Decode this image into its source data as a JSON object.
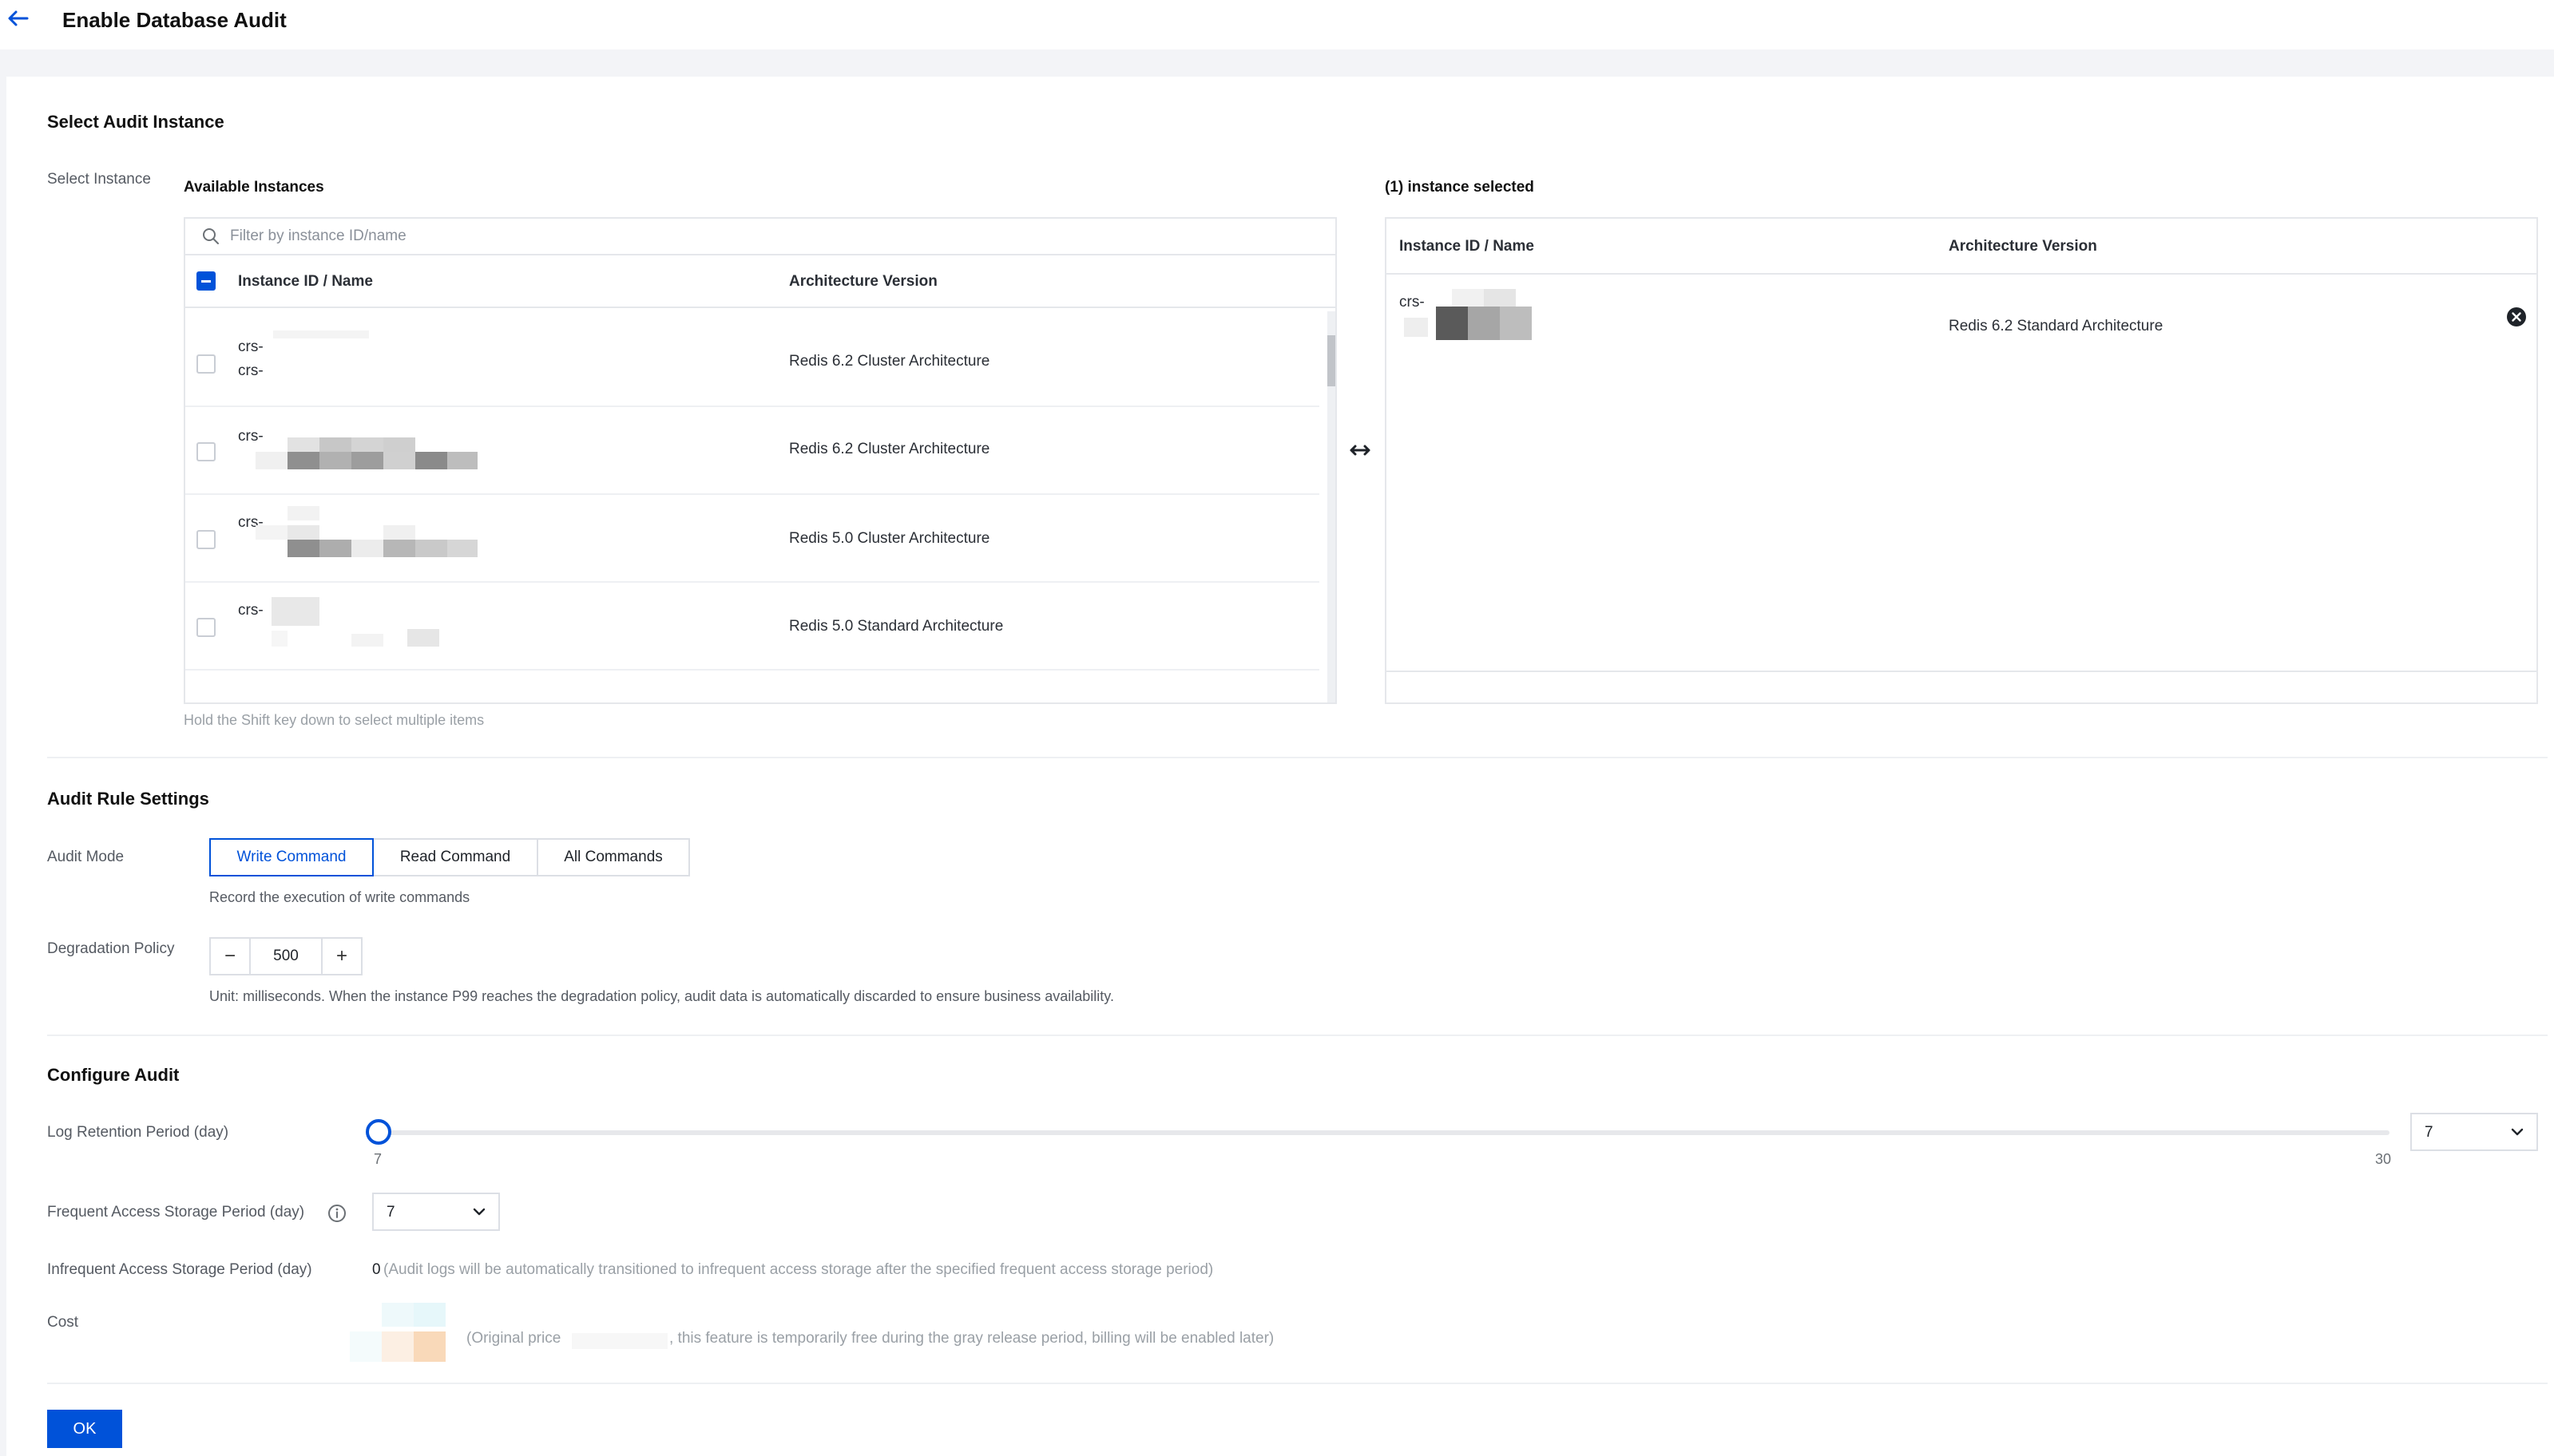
{
  "header": {
    "title": "Enable Database Audit"
  },
  "select_instance": {
    "section_title": "Select Audit Instance",
    "label": "Select Instance",
    "available": {
      "title": "Available Instances",
      "search_placeholder": "Filter by instance ID/name",
      "columns": [
        "Instance ID / Name",
        "Architecture Version"
      ],
      "rows": [
        {
          "id_line1": "crs-",
          "id_line2": "crs-",
          "version": "Redis 6.2 Cluster Architecture"
        },
        {
          "id_line1": "crs-",
          "id_line2": "",
          "version": "Redis 6.2 Cluster Architecture"
        },
        {
          "id_line1": "crs-",
          "id_line2": "",
          "version": "Redis 5.0 Cluster Architecture"
        },
        {
          "id_line1": "crs-",
          "id_line2": "",
          "version": "Redis 5.0 Standard Architecture"
        }
      ]
    },
    "selected": {
      "title": "(1) instance selected",
      "columns": [
        "Instance ID / Name",
        "Architecture Version"
      ],
      "rows": [
        {
          "id_line1": "crs-",
          "version": "Redis 6.2 Standard Architecture"
        }
      ]
    },
    "hint": "Hold the Shift key down to select multiple items"
  },
  "audit_rule": {
    "section_title": "Audit Rule Settings",
    "mode_label": "Audit Mode",
    "modes": [
      "Write Command",
      "Read Command",
      "All Commands"
    ],
    "selected_mode": "Write Command",
    "mode_description": "Record the execution of write commands",
    "degradation_label": "Degradation Policy",
    "degradation_value": "500",
    "degradation_minus": "−",
    "degradation_plus": "+",
    "degradation_hint": "Unit: milliseconds. When the instance P99 reaches the degradation policy, audit data is automatically discarded to ensure business availability."
  },
  "configure": {
    "section_title": "Configure Audit",
    "retention_label": "Log Retention Period (day)",
    "retention_min": "7",
    "retention_max": "30",
    "retention_value": "7",
    "frequent_label": "Frequent Access Storage Period (day)",
    "frequent_value": "7",
    "infrequent_label": "Infrequent Access Storage Period (day)",
    "infrequent_value": "0",
    "infrequent_hint": "(Audit logs will be automatically transitioned to infrequent access storage after the specified frequent access storage period)",
    "cost_label": "Cost",
    "cost_hint_prefix": "(Original price",
    "cost_hint_suffix": ", this feature is temporarily free during the gray release period, billing will be enabled later)"
  },
  "footer": {
    "ok_label": "OK"
  },
  "colors": {
    "primary": "#0052d9",
    "background": "#f3f4f7",
    "border": "#e5e7eb"
  }
}
